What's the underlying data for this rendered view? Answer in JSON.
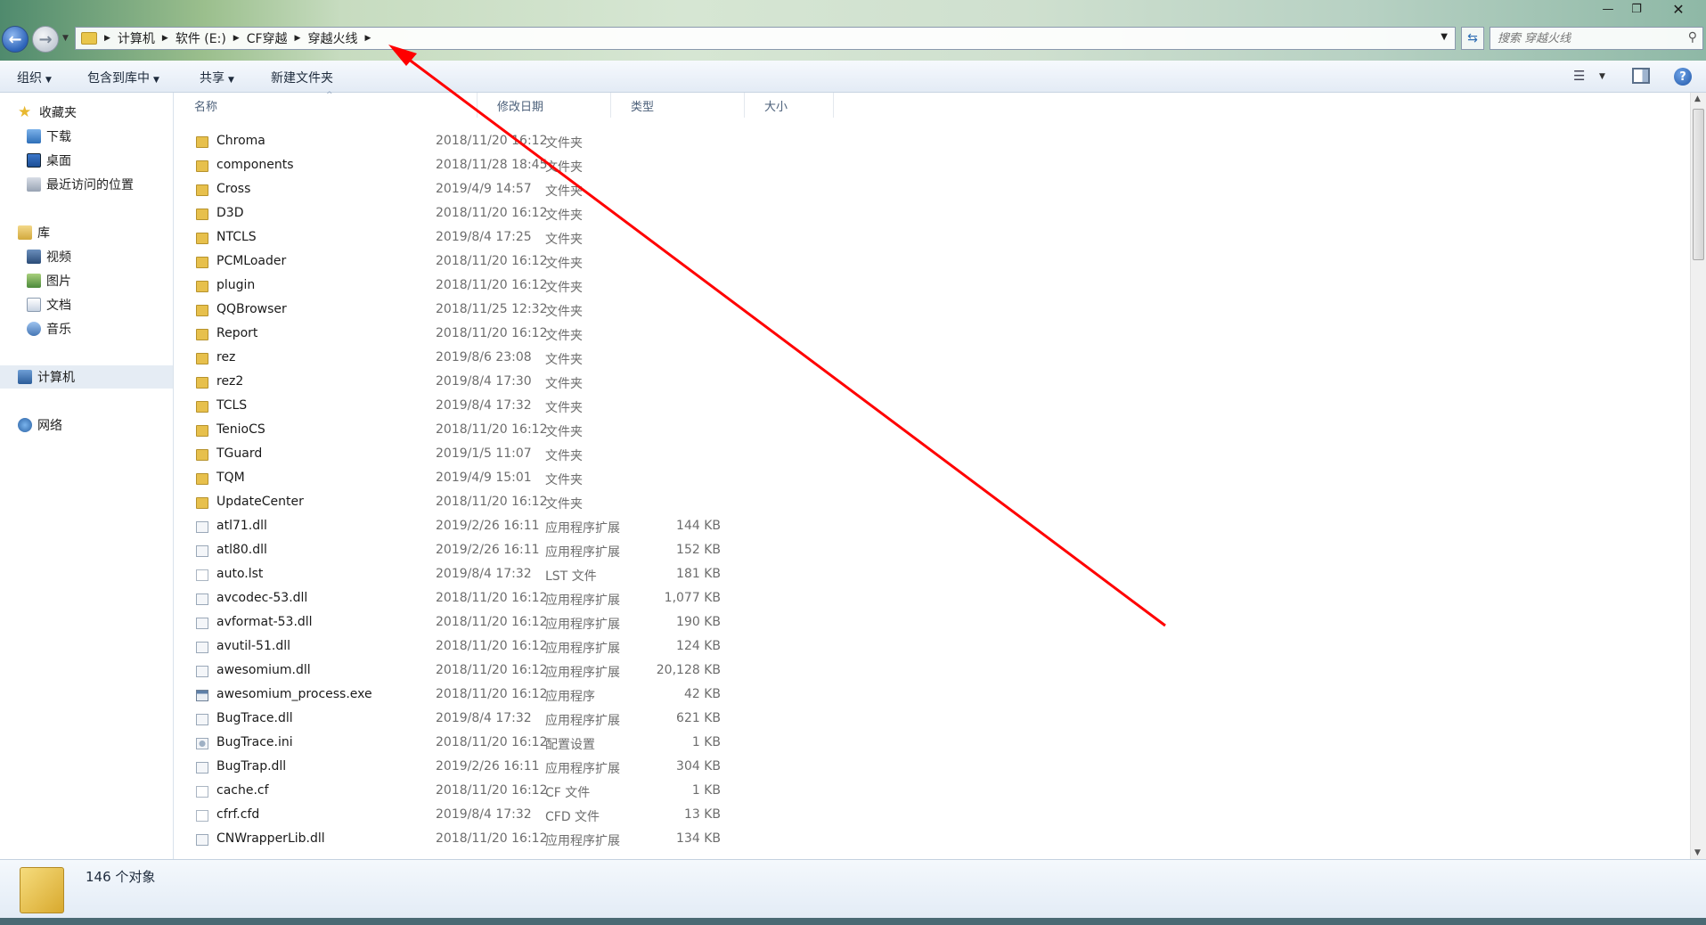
{
  "window": {
    "controls": {
      "minimize": "—",
      "maximize": "❐",
      "close": "✕"
    }
  },
  "navigation": {
    "back": "←",
    "forward": "→"
  },
  "address": {
    "crumbs": [
      "计算机",
      "软件 (E:)",
      "CF穿越",
      "穿越火线"
    ]
  },
  "search": {
    "placeholder": "搜索 穿越火线"
  },
  "toolbar": {
    "organize": "组织",
    "include_in_library": "包含到库中",
    "share": "共享",
    "new_folder": "新建文件夹"
  },
  "sidebar": {
    "favorites": {
      "label": "收藏夹",
      "items": [
        "下载",
        "桌面",
        "最近访问的位置"
      ]
    },
    "libraries": {
      "label": "库",
      "items": [
        "视频",
        "图片",
        "文档",
        "音乐"
      ]
    },
    "computer": "计算机",
    "network": "网络"
  },
  "columns": {
    "name": "名称",
    "date": "修改日期",
    "type": "类型",
    "size": "大小"
  },
  "files": [
    {
      "name": "Chroma",
      "date": "2018/11/20 16:12",
      "type": "文件夹",
      "size": "",
      "icon": "folder"
    },
    {
      "name": "components",
      "date": "2018/11/28 18:45",
      "type": "文件夹",
      "size": "",
      "icon": "folder"
    },
    {
      "name": "Cross",
      "date": "2019/4/9 14:57",
      "type": "文件夹",
      "size": "",
      "icon": "folder"
    },
    {
      "name": "D3D",
      "date": "2018/11/20 16:12",
      "type": "文件夹",
      "size": "",
      "icon": "folder"
    },
    {
      "name": "NTCLS",
      "date": "2019/8/4 17:25",
      "type": "文件夹",
      "size": "",
      "icon": "folder"
    },
    {
      "name": "PCMLoader",
      "date": "2018/11/20 16:12",
      "type": "文件夹",
      "size": "",
      "icon": "folder"
    },
    {
      "name": "plugin",
      "date": "2018/11/20 16:12",
      "type": "文件夹",
      "size": "",
      "icon": "folder"
    },
    {
      "name": "QQBrowser",
      "date": "2018/11/25 12:32",
      "type": "文件夹",
      "size": "",
      "icon": "folder"
    },
    {
      "name": "Report",
      "date": "2018/11/20 16:12",
      "type": "文件夹",
      "size": "",
      "icon": "folder"
    },
    {
      "name": "rez",
      "date": "2019/8/6 23:08",
      "type": "文件夹",
      "size": "",
      "icon": "folder"
    },
    {
      "name": "rez2",
      "date": "2019/8/4 17:30",
      "type": "文件夹",
      "size": "",
      "icon": "folder"
    },
    {
      "name": "TCLS",
      "date": "2019/8/4 17:32",
      "type": "文件夹",
      "size": "",
      "icon": "folder"
    },
    {
      "name": "TenioCS",
      "date": "2018/11/20 16:12",
      "type": "文件夹",
      "size": "",
      "icon": "folder"
    },
    {
      "name": "TGuard",
      "date": "2019/1/5 11:07",
      "type": "文件夹",
      "size": "",
      "icon": "folder"
    },
    {
      "name": "TQM",
      "date": "2019/4/9 15:01",
      "type": "文件夹",
      "size": "",
      "icon": "folder"
    },
    {
      "name": "UpdateCenter",
      "date": "2018/11/20 16:12",
      "type": "文件夹",
      "size": "",
      "icon": "folder"
    },
    {
      "name": "atl71.dll",
      "date": "2019/2/26 16:11",
      "type": "应用程序扩展",
      "size": "144 KB",
      "icon": "dll"
    },
    {
      "name": "atl80.dll",
      "date": "2019/2/26 16:11",
      "type": "应用程序扩展",
      "size": "152 KB",
      "icon": "dll"
    },
    {
      "name": "auto.lst",
      "date": "2019/8/4 17:32",
      "type": "LST 文件",
      "size": "181 KB",
      "icon": "plain"
    },
    {
      "name": "avcodec-53.dll",
      "date": "2018/11/20 16:12",
      "type": "应用程序扩展",
      "size": "1,077 KB",
      "icon": "dll"
    },
    {
      "name": "avformat-53.dll",
      "date": "2018/11/20 16:12",
      "type": "应用程序扩展",
      "size": "190 KB",
      "icon": "dll"
    },
    {
      "name": "avutil-51.dll",
      "date": "2018/11/20 16:12",
      "type": "应用程序扩展",
      "size": "124 KB",
      "icon": "dll"
    },
    {
      "name": "awesomium.dll",
      "date": "2018/11/20 16:12",
      "type": "应用程序扩展",
      "size": "20,128 KB",
      "icon": "dll"
    },
    {
      "name": "awesomium_process.exe",
      "date": "2018/11/20 16:12",
      "type": "应用程序",
      "size": "42 KB",
      "icon": "exe"
    },
    {
      "name": "BugTrace.dll",
      "date": "2019/8/4 17:32",
      "type": "应用程序扩展",
      "size": "621 KB",
      "icon": "dll"
    },
    {
      "name": "BugTrace.ini",
      "date": "2018/11/20 16:12",
      "type": "配置设置",
      "size": "1 KB",
      "icon": "ini"
    },
    {
      "name": "BugTrap.dll",
      "date": "2019/2/26 16:11",
      "type": "应用程序扩展",
      "size": "304 KB",
      "icon": "dll"
    },
    {
      "name": "cache.cf",
      "date": "2018/11/20 16:12",
      "type": "CF 文件",
      "size": "1 KB",
      "icon": "plain"
    },
    {
      "name": "cfrf.cfd",
      "date": "2019/8/4 17:32",
      "type": "CFD 文件",
      "size": "13 KB",
      "icon": "plain"
    },
    {
      "name": "CNWrapperLib.dll",
      "date": "2018/11/20 16:12",
      "type": "应用程序扩展",
      "size": "134 KB",
      "icon": "dll"
    }
  ],
  "status": {
    "object_count": "146 个对象"
  },
  "annotation": {
    "color": "#ff0000"
  }
}
